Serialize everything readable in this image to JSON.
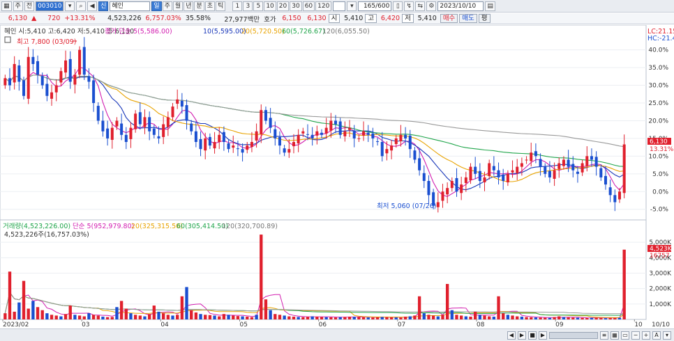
{
  "toolbar": {
    "period_label": "주",
    "total_label": "전",
    "code": "003010",
    "badge": "신",
    "name": "혜인",
    "periods": [
      "일",
      "주",
      "월",
      "년",
      "분",
      "초",
      "틱"
    ],
    "minutes": [
      "1",
      "3",
      "5",
      "10",
      "20",
      "30",
      "60",
      "120"
    ],
    "count": "165/600",
    "date": "2023/10/10"
  },
  "quote": {
    "price": "6,130",
    "arrow": "▲",
    "change": "720",
    "rate": "+13.31%",
    "volume": "4,523,226",
    "volume_pct": "6,757.03%",
    "turnover": "35.58%",
    "amount": "27,977백만",
    "ask_label": "호가",
    "ask": "6,150",
    "bid": "6,130",
    "open_label": "시",
    "open": "5,410",
    "high_label": "고",
    "high": "6,420",
    "low_label": "저",
    "low": "5,410",
    "buy_btn": "매수",
    "sell_btn": "매도",
    "eval_btn": "평"
  },
  "price_pane": {
    "info": "혜인 시:5,410 고:6,420 저:5,410 종:6,130",
    "ma_title": "종가 단순 5(5,586.00)",
    "ma10": "10(5,595.00)",
    "ma20": "20(5,720.50)",
    "ma60": "60(5,726.67)",
    "ma120": "120(6,055.50)",
    "high_note": "최고 7,800 (03/09)",
    "low_note": "최저 5,060 (07/26)",
    "lc": "LC:21.15",
    "hc": "HC:-21.4",
    "last_tag": "6,130",
    "pct_tag": "13.31%"
  },
  "volume_pane": {
    "title": "거래량(4,523,226.00)",
    "ma_title": "단순 5(952,979.80)",
    "ma20": "20(325,315.50)",
    "ma60": "60(305,414.50)",
    "ma120": "120(320,700.89)",
    "last_line": "4,523,226주(16,757.03%)",
    "last_tag": "4,523K",
    "pct_tag": "16757"
  },
  "x_axis": {
    "labels": [
      "2023/02",
      "03",
      "04",
      "05",
      "06",
      "07",
      "08",
      "09",
      "10"
    ],
    "right_label": "10/10"
  },
  "colors": {
    "up": "#e0202d",
    "down": "#1a4fd0",
    "ma5": "#d21fb0",
    "ma10": "#1836b8",
    "ma20": "#e8a300",
    "ma60": "#1fa54a",
    "ma120": "#999999"
  },
  "chart_data": [
    {
      "type": "candlestick",
      "title": "혜인",
      "y_axis": "percent",
      "ylim": [
        -8,
        47
      ],
      "y_ticks": [
        "40.0%",
        "35.0%",
        "30.0%",
        "25.0%",
        "20.0%",
        "15.0%",
        "10.0%",
        "5.0%",
        "0.0%",
        "-5.0%"
      ],
      "x_labels": [
        "2023/02",
        "03",
        "04",
        "05",
        "06",
        "07",
        "08",
        "09",
        "10"
      ],
      "close_pct": [
        32,
        30,
        36,
        31,
        27,
        38,
        36,
        33,
        30,
        27,
        28,
        30,
        34,
        37,
        31,
        33,
        40,
        33,
        31,
        25,
        20,
        17,
        15,
        18,
        20,
        16,
        14,
        18,
        22,
        19,
        21,
        17,
        16,
        15,
        19,
        21,
        24,
        26,
        24,
        20,
        17,
        14,
        12,
        15,
        13,
        14,
        16,
        14,
        12,
        13,
        12,
        11,
        13,
        14,
        17,
        23,
        20,
        18,
        15,
        13,
        11,
        12,
        14,
        16,
        17,
        16,
        15,
        17,
        16,
        18,
        20,
        19,
        16,
        17,
        18,
        15,
        15,
        17,
        16,
        15,
        14,
        10,
        12,
        13,
        15,
        16,
        15,
        12,
        9,
        6,
        3,
        -1,
        -4,
        -3,
        0,
        1,
        3,
        0,
        2,
        4,
        7,
        5,
        3,
        4,
        8,
        6,
        4,
        3,
        5,
        6,
        7,
        8,
        9,
        11,
        10,
        7,
        5,
        4,
        6,
        8,
        9,
        7,
        6,
        5,
        8,
        10,
        9,
        7,
        4,
        2,
        -1,
        -3,
        0,
        13.31
      ],
      "low_note_index": 93,
      "high_note_index": 16
    },
    {
      "type": "bar",
      "title": "거래량",
      "y_ticks": [
        "5,000K",
        "4,000K",
        "3,000K",
        "2,000K",
        "1,000K"
      ],
      "ylim": [
        0,
        6000
      ],
      "values_k": [
        400,
        3100,
        500,
        1100,
        2500,
        700,
        1200,
        800,
        600,
        400,
        300,
        250,
        200,
        350,
        900,
        300,
        250,
        200,
        400,
        300,
        250,
        180,
        150,
        160,
        800,
        1200,
        700,
        400,
        300,
        250,
        200,
        350,
        900,
        500,
        400,
        300,
        250,
        300,
        1500,
        2100,
        600,
        450,
        350,
        300,
        280,
        250,
        200,
        350,
        300,
        250,
        220,
        200,
        180,
        150,
        300,
        5500,
        1300,
        600,
        350,
        300,
        250,
        200,
        180,
        160,
        150,
        170,
        200,
        180,
        160,
        150,
        140,
        130,
        150,
        160,
        180,
        170,
        150,
        140,
        130,
        120,
        140,
        160,
        150,
        140,
        130,
        120,
        180,
        200,
        250,
        1500,
        400,
        300,
        250,
        200,
        300,
        2300,
        600,
        300,
        250,
        200,
        180,
        500,
        300,
        250,
        200,
        180,
        1500,
        400,
        300,
        250,
        200,
        180,
        150,
        140,
        130,
        120,
        110,
        100,
        150,
        200,
        150,
        130,
        120,
        110,
        100,
        90,
        100,
        110,
        90,
        80,
        90,
        100,
        110,
        4523
      ]
    }
  ]
}
